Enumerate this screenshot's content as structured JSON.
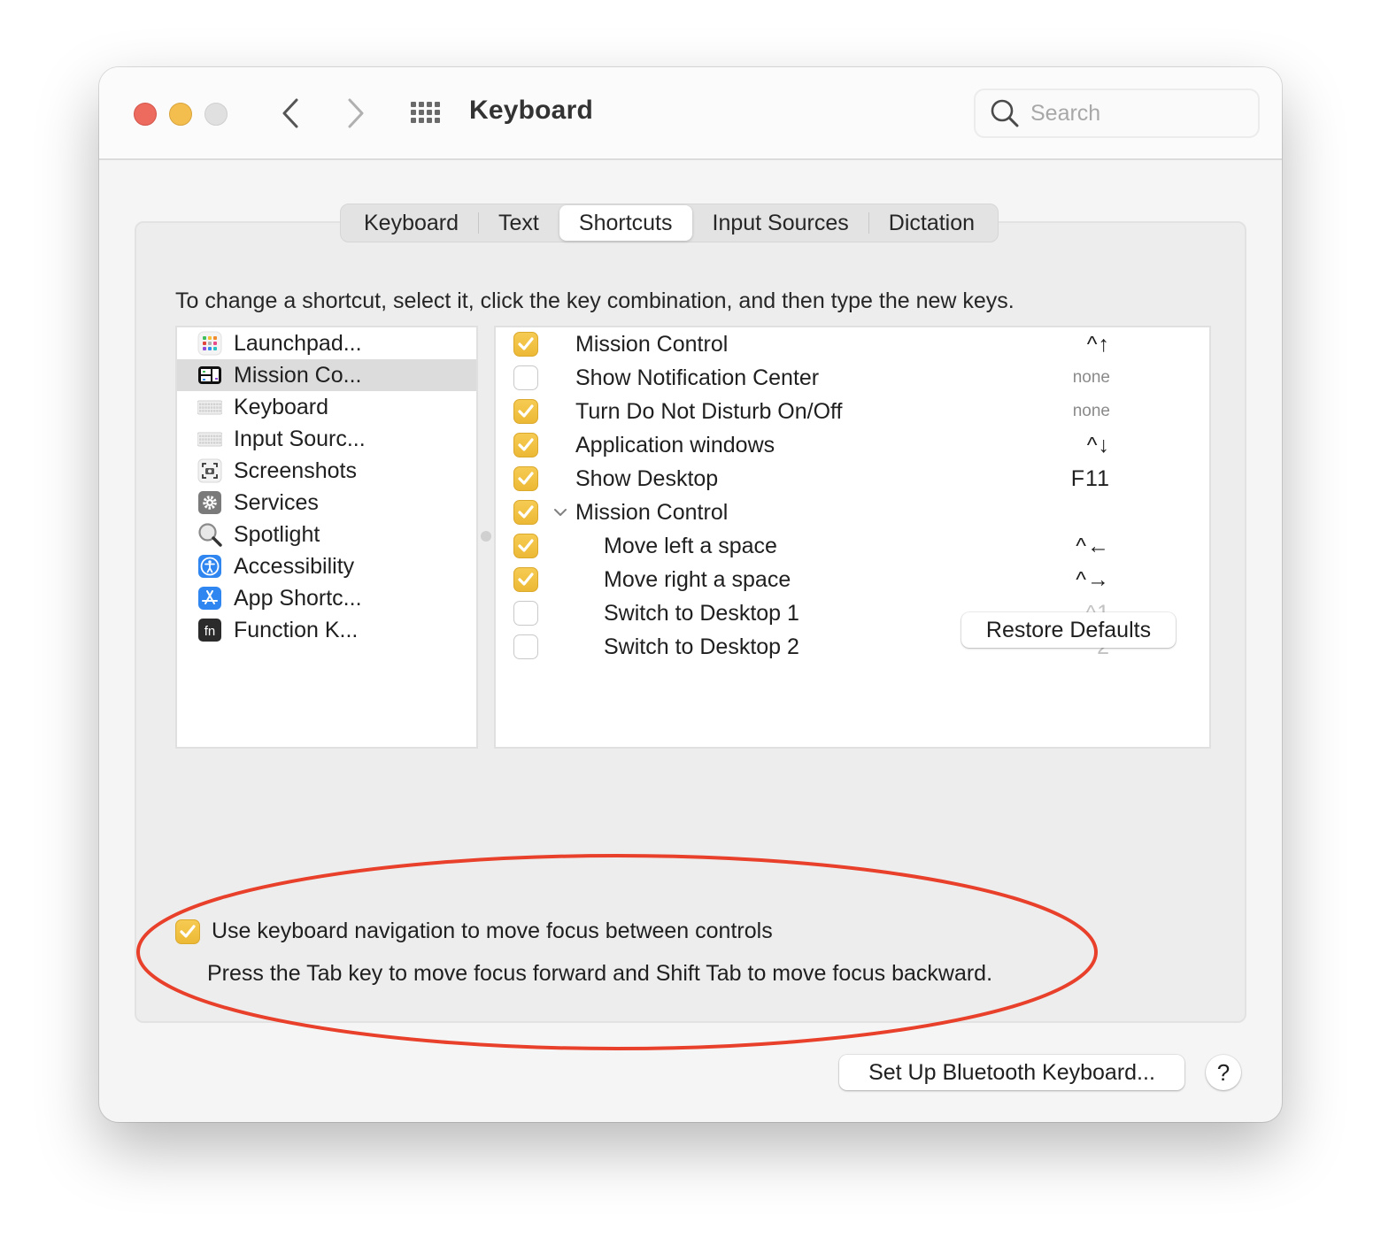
{
  "window": {
    "title": "Keyboard",
    "search_placeholder": "Search",
    "search_value": ""
  },
  "toolbar": {
    "back_icon": "chevron-left-icon",
    "forward_icon": "chevron-right-icon",
    "grid_icon": "show-all-grid-icon"
  },
  "tabs": [
    {
      "label": "Keyboard",
      "active": false
    },
    {
      "label": "Text",
      "active": false
    },
    {
      "label": "Shortcuts",
      "active": true
    },
    {
      "label": "Input Sources",
      "active": false
    },
    {
      "label": "Dictation",
      "active": false
    }
  ],
  "instruction": "To change a shortcut, select it, click the key combination, and then type the new keys.",
  "categories": [
    {
      "label": "Launchpad...",
      "icon": "launchpad-icon",
      "selected": false
    },
    {
      "label": "Mission Co...",
      "icon": "mission-control-icon",
      "selected": true
    },
    {
      "label": "Keyboard",
      "icon": "keyboard-icon",
      "selected": false
    },
    {
      "label": "Input Sourc...",
      "icon": "input-sources-icon",
      "selected": false
    },
    {
      "label": "Screenshots",
      "icon": "screenshot-icon",
      "selected": false
    },
    {
      "label": "Services",
      "icon": "gear-icon",
      "selected": false
    },
    {
      "label": "Spotlight",
      "icon": "magnifier-icon",
      "selected": false
    },
    {
      "label": "Accessibility",
      "icon": "accessibility-icon",
      "selected": false
    },
    {
      "label": "App Shortc...",
      "icon": "app-store-icon",
      "selected": false
    },
    {
      "label": "Function K...",
      "icon": "fn-key-icon",
      "selected": false
    }
  ],
  "shortcuts": [
    {
      "label": "Mission Control",
      "checked": true,
      "key": "^↑",
      "level": 0,
      "disclosure": false,
      "key_style": "normal"
    },
    {
      "label": "Show Notification Center",
      "checked": false,
      "key": "none",
      "level": 0,
      "disclosure": false,
      "key_style": "none"
    },
    {
      "label": "Turn Do Not Disturb On/Off",
      "checked": true,
      "key": "none",
      "level": 0,
      "disclosure": false,
      "key_style": "none"
    },
    {
      "label": "Application windows",
      "checked": true,
      "key": "^↓",
      "level": 0,
      "disclosure": false,
      "key_style": "normal"
    },
    {
      "label": "Show Desktop",
      "checked": true,
      "key": "F11",
      "level": 0,
      "disclosure": false,
      "key_style": "normal"
    },
    {
      "label": "Mission Control",
      "checked": true,
      "key": "",
      "level": 0,
      "disclosure": true,
      "key_style": "normal"
    },
    {
      "label": "Move left a space",
      "checked": true,
      "key": "^←",
      "level": 1,
      "disclosure": false,
      "key_style": "normal"
    },
    {
      "label": "Move right a space",
      "checked": true,
      "key": "^→",
      "level": 1,
      "disclosure": false,
      "key_style": "normal"
    },
    {
      "label": "Switch to Desktop 1",
      "checked": false,
      "key": "^1",
      "level": 1,
      "disclosure": false,
      "key_style": "dim"
    },
    {
      "label": "Switch to Desktop 2",
      "checked": false,
      "key": "^2",
      "level": 1,
      "disclosure": false,
      "key_style": "dim"
    }
  ],
  "buttons": {
    "restore_defaults": "Restore Defaults",
    "bluetooth": "Set Up Bluetooth Keyboard...",
    "help": "?"
  },
  "keyboard_navigation": {
    "checked": true,
    "label": "Use keyboard navigation to move focus between controls",
    "description": "Press the Tab key to move focus forward and Shift Tab to move focus backward."
  },
  "colors": {
    "accent_checkbox": "#f4c243",
    "annotation_ellipse": "#e8402a",
    "close": "#ec6a5e",
    "minimize": "#f4be4f",
    "maximize_disabled": "#e0e0e0"
  }
}
